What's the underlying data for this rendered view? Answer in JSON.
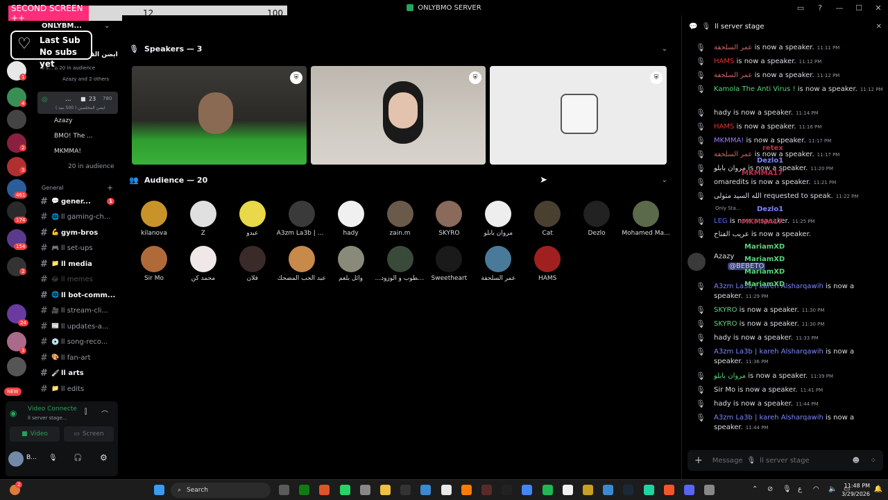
{
  "titlebar": {
    "title": "ONLYBMO SERVER"
  },
  "overlay": {
    "tag": "SECOND SCREEN ++",
    "count": "12",
    "goal": "100"
  },
  "last_sub": {
    "line1": "Last Sub",
    "line2": "No subs yet"
  },
  "rail": {
    "badges": [
      "1",
      "4",
      "2",
      "3",
      "461",
      "174",
      "154",
      "2",
      "24",
      "3"
    ],
    "new_label": "NEW"
  },
  "sidebar": {
    "server_name": "ONLYBM...",
    "event_title": "ايضن الف",
    "event_line1": "ll s... ⌂ 20 in audience",
    "event_line2": "Azazy and 2 others",
    "stage_channel": {
      "name": "...",
      "count_a": "23",
      "count_b": "780",
      "subtitle": "ايضن المخلصين ( 500 بنيه )"
    },
    "stage_members": [
      "Azazy",
      "BMO! The ...",
      "MKMMA!"
    ],
    "stage_audience": "20 in audience",
    "category": "General",
    "channels": [
      {
        "icon": "💬",
        "label": "gener...",
        "badge": "1",
        "state": "unread"
      },
      {
        "icon": "🌐",
        "label": "ll gaming-ch...",
        "state": "normal"
      },
      {
        "icon": "💪",
        "label": "gym-bros",
        "state": "unread"
      },
      {
        "icon": "🎮",
        "label": "ll set-ups",
        "state": "normal"
      },
      {
        "icon": "📁",
        "label": "ll media",
        "state": "unread"
      },
      {
        "icon": "😂",
        "label": "ll memes",
        "state": "muted"
      },
      {
        "icon": "🌐",
        "label": "ll bot-comm...",
        "state": "unread"
      },
      {
        "icon": "🎥",
        "label": "ll stream-cli...",
        "state": "normal"
      },
      {
        "icon": "📰",
        "label": "ll updates-a...",
        "state": "normal"
      },
      {
        "icon": "💿",
        "label": "ll song-reco...",
        "state": "normal"
      },
      {
        "icon": "🎨",
        "label": "ll fan-art",
        "state": "normal"
      },
      {
        "icon": "🖌",
        "label": "ll arts",
        "state": "unread"
      },
      {
        "icon": "📁",
        "label": "ll edits",
        "state": "normal"
      }
    ]
  },
  "voice": {
    "status": "Video Connecte",
    "channel": "ll server stage...",
    "video_label": "Video",
    "screen_label": "Screen",
    "user": "B..."
  },
  "stage": {
    "speakers_header": "Speakers — 3",
    "audience_header": "Audience — 20",
    "audience": [
      "kilanova",
      "Z",
      "عبدو",
      "A3zm La3b | k...",
      "hady",
      "zain.m",
      "SKYRO",
      "مروان بابلو",
      "Cat",
      "Dezlo",
      "Mohamed Ma...",
      "Sir Mo",
      "محمد كن",
      "فلان",
      "عبد الحب المضحك",
      "وائل بلعم",
      "...ع الطوب و الوزود",
      "Sweetheart",
      "عمر السلحفة",
      "HAMS"
    ]
  },
  "chat": {
    "header": "ll server stage",
    "messages": [
      {
        "user": "عمر السلحفة",
        "color": "#c96a6a",
        "text": "is now a speaker.",
        "time": "11:11 PM"
      },
      {
        "user": "HAMS",
        "color": "#e03434",
        "text": "is now a speaker.",
        "time": "11:12 PM"
      },
      {
        "user": "عمر السلحفة",
        "color": "#c96a6a",
        "text": "is now a speaker.",
        "time": "11:12 PM"
      },
      {
        "user": "Kamola The Anti Virus !",
        "color": "#57d67a",
        "text": "is now a speaker.",
        "time": "11:12 PM"
      },
      {
        "user": "hady",
        "color": "#dbdee1",
        "text": "is now a speaker.",
        "time": "11:14 PM"
      },
      {
        "user": "HAMS",
        "color": "#e03434",
        "text": "is now a speaker.",
        "time": "11:16 PM"
      },
      {
        "user": "MKMMA!",
        "color": "#9b7bff",
        "text": "is now a speaker.",
        "time": "11:17 PM"
      },
      {
        "user": "عمر السلحفة",
        "color": "#c96a6a",
        "text": "is now a speaker.",
        "time": "11:17 PM"
      },
      {
        "user": "مروان بابلو",
        "color": "#dbdee1",
        "text": "is now a speaker.",
        "time": "11:20 PM"
      },
      {
        "user": "omaredits",
        "color": "#dbdee1",
        "text": "is now a speaker.",
        "time": "11:21 PM"
      },
      {
        "user": "الله السيد متولى",
        "color": "#dbdee1",
        "text": "requested to speak.",
        "time": "11:22 PM"
      },
      {
        "user": "LEG",
        "color": "#5865f2",
        "text": "is now a speaker.",
        "time": "11:25 PM"
      },
      {
        "user": "عريب الفتاح",
        "color": "#dbdee1",
        "text": "is now a speaker.",
        "time": ""
      },
      {
        "user": "A3zm La3b | kareh Alsharqawih",
        "color": "#7c86ff",
        "text": "is now a speaker.",
        "time": "11:29 PM"
      },
      {
        "user": "SKYRO",
        "color": "#57d67a",
        "text": "is now a speaker.",
        "time": "11:30 PM"
      },
      {
        "user": "SKYRO",
        "color": "#57d67a",
        "text": "is now a speaker.",
        "time": "11:30 PM"
      },
      {
        "user": "hady",
        "color": "#dbdee1",
        "text": "is now a speaker.",
        "time": "11:33 PM"
      },
      {
        "user": "A3zm La3b | kareh Alsharqawih",
        "color": "#7c86ff",
        "text": "is now a speaker.",
        "time": "11:36 PM"
      },
      {
        "user": "مروان بابلو",
        "color": "#57d67a",
        "text": "is now a speaker.",
        "time": "11:39 PM"
      },
      {
        "user": "Sir Mo",
        "color": "#dbdee1",
        "text": "is now a speaker.",
        "time": "11:41 PM"
      },
      {
        "user": "hady",
        "color": "#dbdee1",
        "text": "is now a speaker.",
        "time": "11:44 PM"
      },
      {
        "user": "A3zm La3b | kareh Alsharqawih",
        "color": "#7c86ff",
        "text": "is now a speaker.",
        "time": "11:44 PM"
      }
    ],
    "only_stage_note": "Only Sta...",
    "reply_user": "Azazy",
    "reply_mention": "@BEBETO",
    "overlay_names": [
      "retex",
      "Dezlo1",
      "MKMMA17",
      "Dezlo1",
      "MKMMA17",
      "MariamXD",
      "MariamXD",
      "MariamXD",
      "MariamXD"
    ],
    "composer_placeholder": "Message",
    "composer_channel": "ll server stage"
  },
  "taskbar": {
    "search_label": "Search",
    "time": "11:48 PM",
    "date": "3/29/2026",
    "notif_badge": "2"
  },
  "colors": {
    "accent": "#5865f2",
    "green": "#23a55a",
    "red": "#f23f43",
    "brand_pink": "#ff2d7a"
  }
}
